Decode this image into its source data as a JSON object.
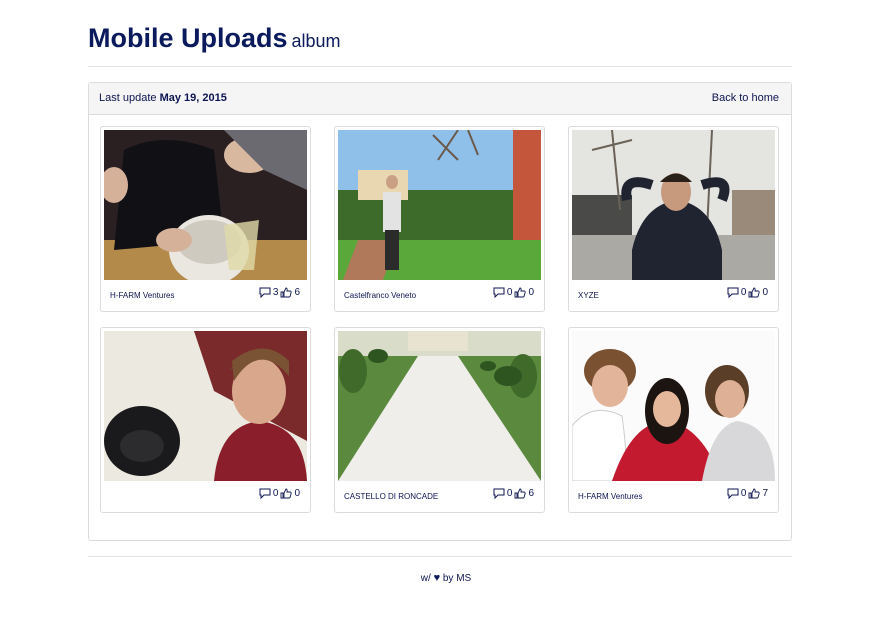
{
  "header": {
    "title": "Mobile Uploads",
    "subtitle": "album"
  },
  "panel": {
    "last_update_label": "Last update",
    "last_update_date": "May 19, 2015",
    "back_link": "Back to home"
  },
  "photos": [
    {
      "caption": "H-FARM Ventures",
      "comments": "3",
      "likes": "6"
    },
    {
      "caption": "Castelfranco Veneto",
      "comments": "0",
      "likes": "0"
    },
    {
      "caption": "XYZE",
      "comments": "0",
      "likes": "0"
    },
    {
      "caption": "",
      "comments": "0",
      "likes": "0"
    },
    {
      "caption": "CASTELLO DI RONCADE",
      "comments": "0",
      "likes": "6"
    },
    {
      "caption": "H-FARM Ventures",
      "comments": "0",
      "likes": "7"
    }
  ],
  "footer": {
    "prefix": "w/",
    "suffix": "by MS"
  },
  "icons": {
    "comment": "comment-icon",
    "like": "thumbs-up-icon",
    "heart": "heart-icon"
  }
}
